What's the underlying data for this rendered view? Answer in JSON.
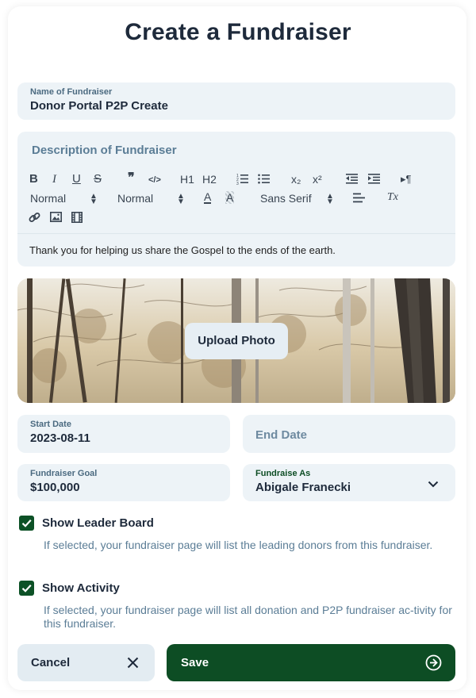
{
  "page": {
    "title": "Create a Fundraiser"
  },
  "name_field": {
    "label": "Name of Fundraiser",
    "value": "Donor Portal P2P Create"
  },
  "description": {
    "label": "Description of Fundraiser",
    "toolbar": {
      "bold": "B",
      "italic": "I",
      "underline": "U",
      "strike": "S",
      "blockquote": "❞",
      "code": "</>",
      "h1": "H1",
      "h2": "H2",
      "ordered_list": "ordered-list-icon",
      "bullet_list": "bullet-list-icon",
      "subscript": "x₂",
      "superscript": "x²",
      "outdent": "outdent-icon",
      "indent": "indent-icon",
      "rtl": "▸¶",
      "header_select": "Normal",
      "size_select": "Normal",
      "font_select": "Sans Serif",
      "color": "A",
      "background": "A",
      "align": "align-icon",
      "clean": "Tx",
      "link": "link-icon",
      "image": "image-icon",
      "video": "video-icon"
    },
    "text": "Thank you for helping us share the Gospel to the ends of the earth."
  },
  "photo": {
    "button_label": "Upload Photo"
  },
  "start_date": {
    "label": "Start Date",
    "value": "2023-08-11"
  },
  "end_date": {
    "placeholder": "End Date"
  },
  "goal": {
    "label": "Fundraiser Goal",
    "value": "$100,000"
  },
  "fundraise_as": {
    "label": "Fundraise As",
    "value": "Abigale Franecki"
  },
  "leader_board": {
    "label": "Show Leader Board",
    "checked": true,
    "help": "If selected, your fundraiser page will list the leading donors from this fundraiser."
  },
  "activity": {
    "label": "Show Activity",
    "checked": true,
    "help": "If selected, your fundraiser page will list all donation and P2P fundraiser ac-tivity for this fundraiser."
  },
  "actions": {
    "cancel": "Cancel",
    "save": "Save"
  },
  "colors": {
    "primary": "#0d4d24",
    "field_bg": "#edf3f7",
    "muted_text": "#5b7d96",
    "heading": "#1e2a3b"
  }
}
